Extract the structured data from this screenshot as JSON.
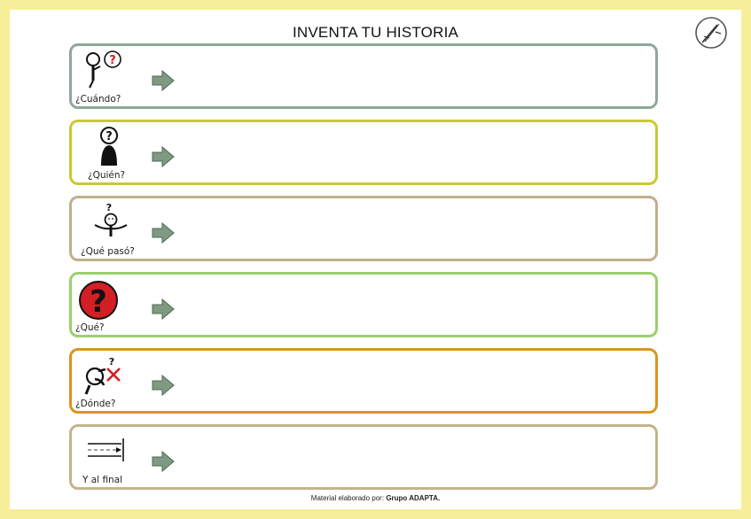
{
  "title": "INVENTA TU HISTORIA",
  "rows": [
    {
      "label": "¿Cuándo?",
      "icon": "person-clock-question-icon",
      "border": "#8fa898"
    },
    {
      "label": "¿Quién?",
      "icon": "person-question-icon",
      "border": "#c9c934"
    },
    {
      "label": "¿Qué pasó?",
      "icon": "person-shrug-question-icon",
      "border": "#bfb08c"
    },
    {
      "label": "¿Qué?",
      "icon": "red-question-mark-icon",
      "border": "#9ccf6e"
    },
    {
      "label": "¿Dónde?",
      "icon": "person-looking-question-icon",
      "border": "#d9951e"
    },
    {
      "label": "Y al final",
      "icon": "finish-line-icon",
      "border": "#c2b48c"
    }
  ],
  "footer": {
    "prefix": "Material elaborado por:",
    "author": "Grupo ADAPTA."
  },
  "colors": {
    "page_border": "#f7ee9a",
    "arrow_fill": "#7f9a82"
  }
}
